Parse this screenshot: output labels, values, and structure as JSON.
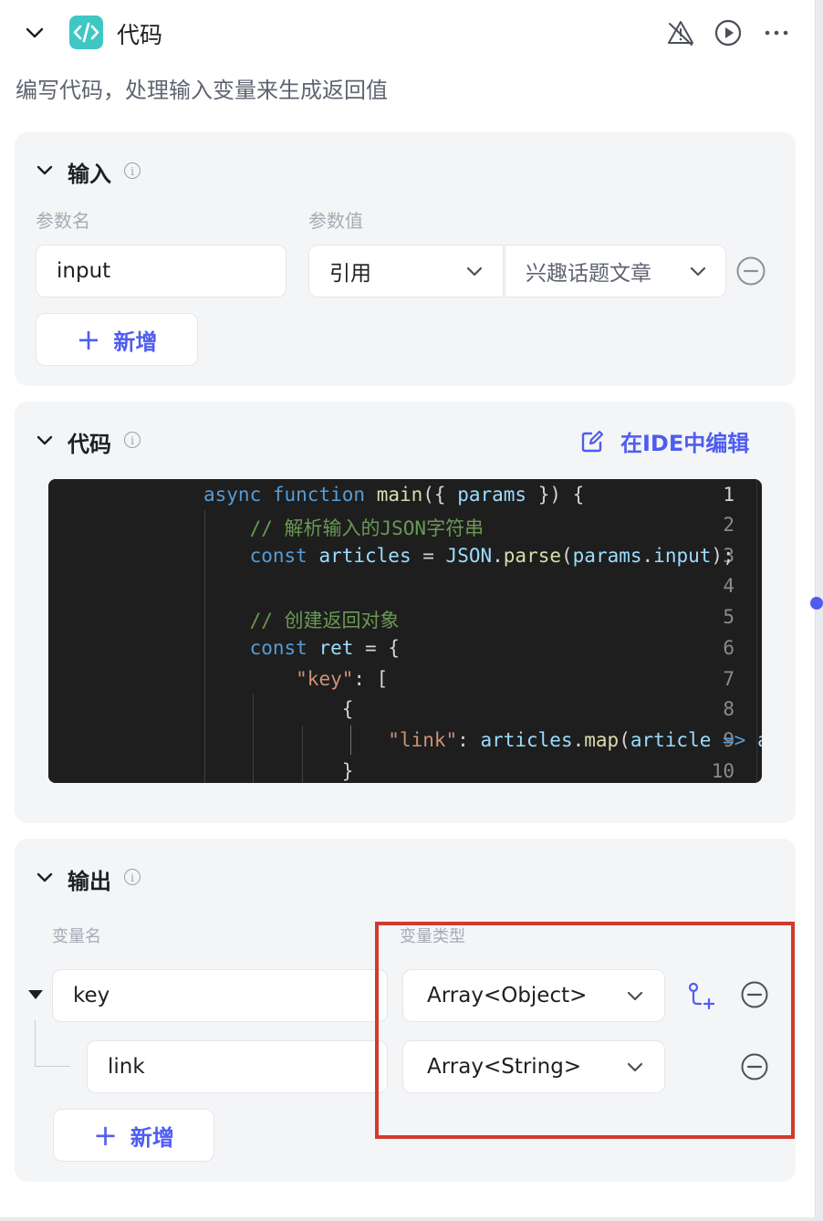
{
  "header": {
    "title": "代码",
    "description": "编写代码，处理输入变量来生成返回值",
    "brand_color": "#3fc7c4",
    "accent_color": "#4e5df0"
  },
  "input_section": {
    "title": "输入",
    "col_param_name": "参数名",
    "col_param_value": "参数值",
    "param_name_value": "input",
    "value_type": "引用",
    "value_ref": "兴趣话题文章",
    "add_label": "新增"
  },
  "code_section": {
    "title": "代码",
    "ide_label": "在IDE中编辑",
    "line_numbers": [
      "1",
      "2",
      "3",
      "4",
      "5",
      "6",
      "7",
      "8",
      "9",
      "10"
    ]
  },
  "output_section": {
    "title": "输出",
    "col_var_name": "变量名",
    "col_var_type": "变量类型",
    "rows": [
      {
        "name": "key",
        "type": "Array<Object>"
      },
      {
        "name": "link",
        "type": "Array<String>"
      }
    ],
    "add_label": "新增"
  }
}
